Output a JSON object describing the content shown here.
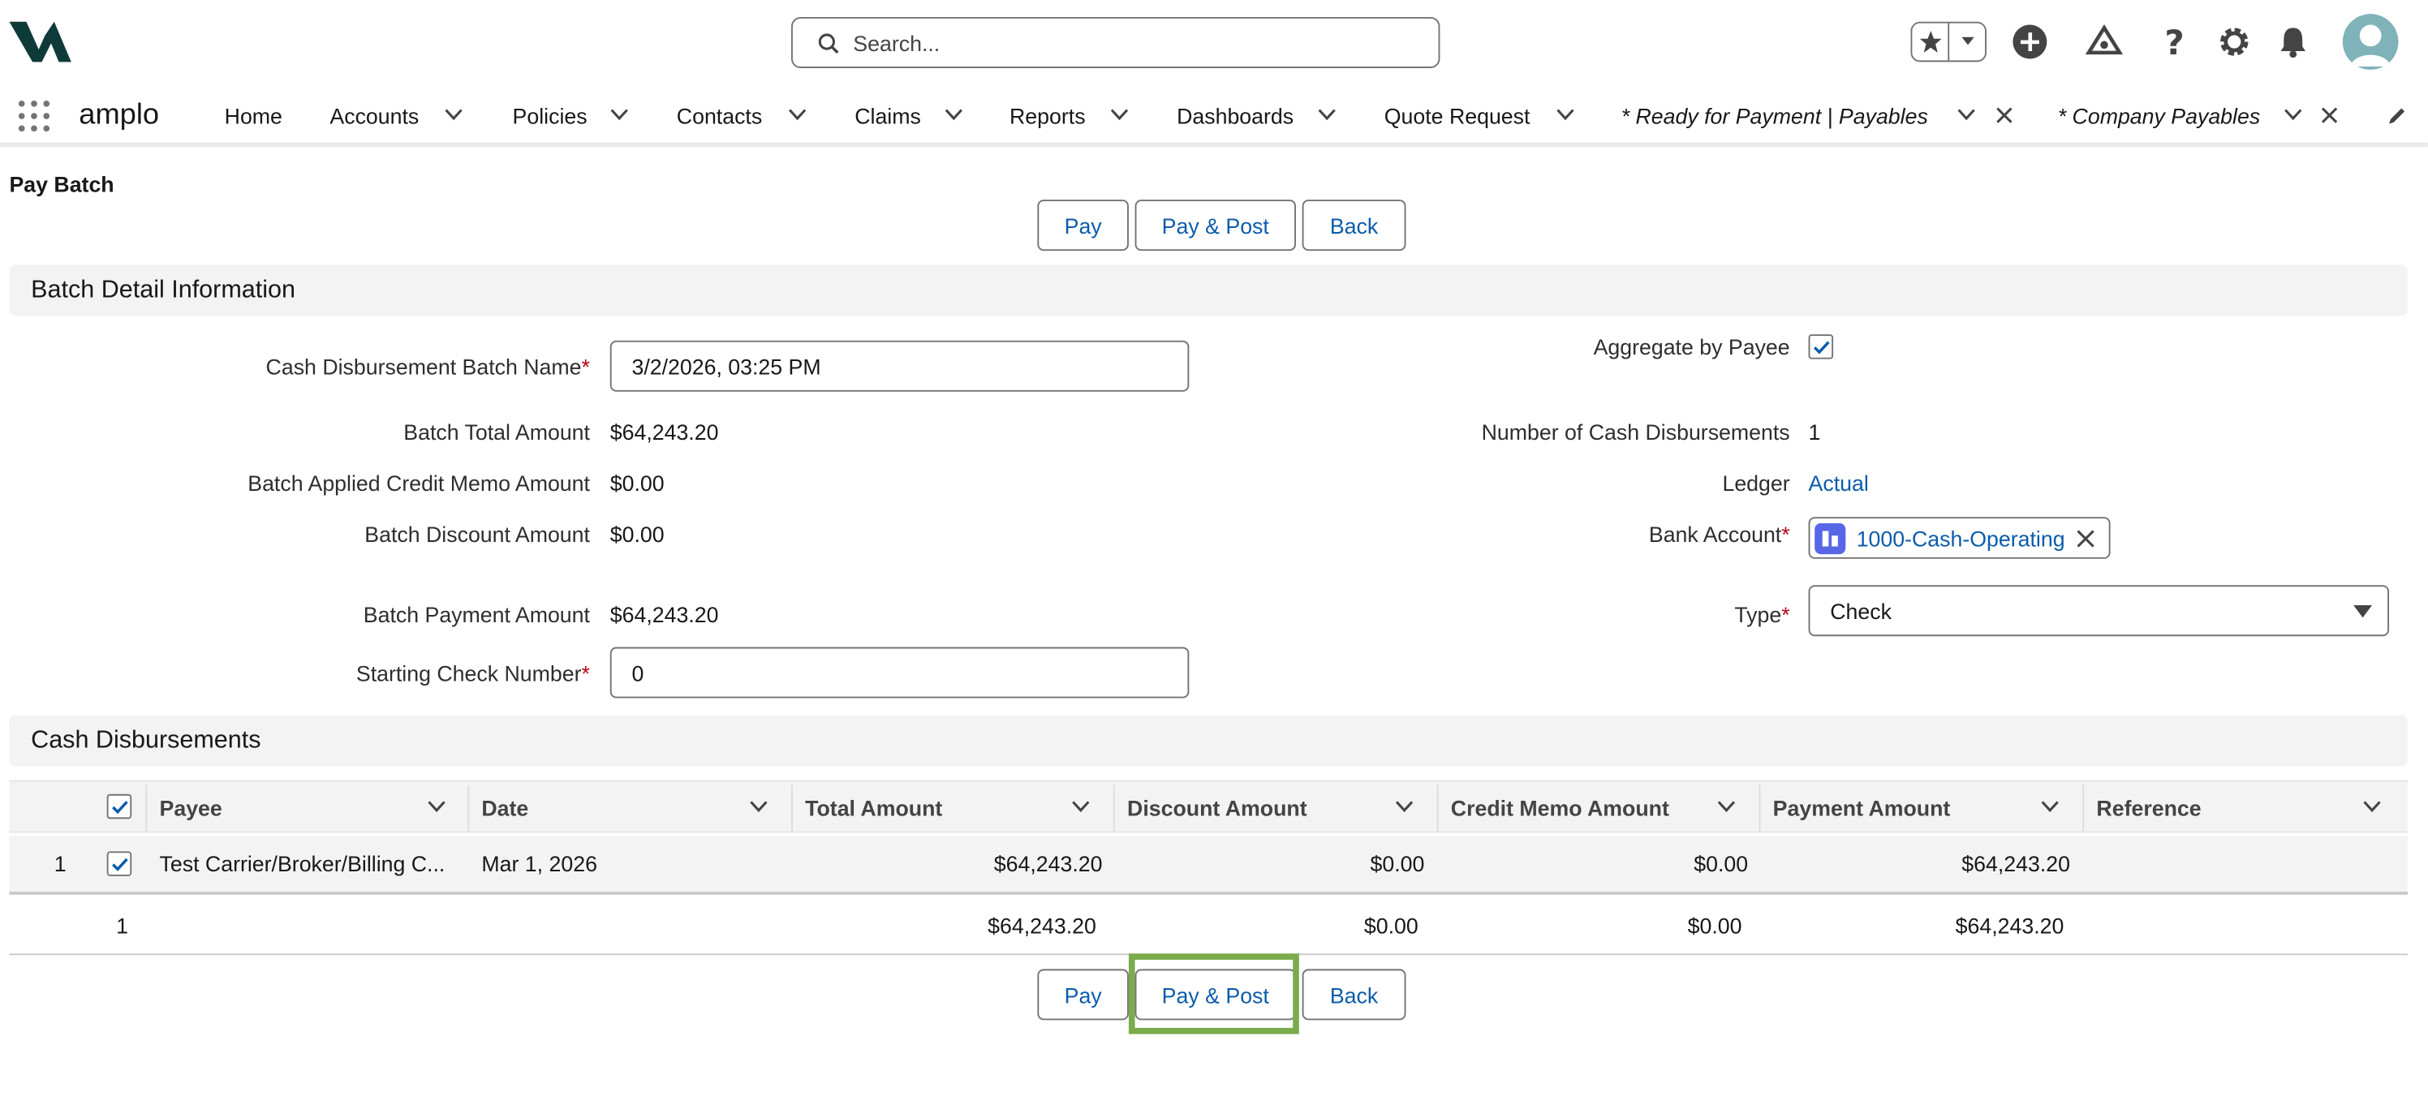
{
  "header": {
    "search_placeholder": "Search...",
    "icons": [
      "logo-icon",
      "star-icon",
      "chevron-down-icon",
      "plus-circle-icon",
      "trailhead-icon",
      "help-icon",
      "gear-icon",
      "bell-icon",
      "avatar-icon"
    ]
  },
  "nav": {
    "app_name": "amplo",
    "items": [
      "Home",
      "Accounts",
      "Policies",
      "Contacts",
      "Claims",
      "Reports",
      "Dashboards",
      "Quote Request"
    ],
    "tabs": [
      "* Ready for Payment | Payables",
      "* Company Payables"
    ]
  },
  "page": {
    "title": "Pay Batch",
    "buttons": {
      "pay": "Pay",
      "pay_post": "Pay & Post",
      "back": "Back"
    }
  },
  "batch": {
    "section_title": "Batch Detail Information",
    "left": [
      {
        "label": "Cash Disbursement Batch Name",
        "value": "3/2/2026, 03:25 PM"
      },
      {
        "label": "Batch Total Amount",
        "value": "$64,243.20"
      },
      {
        "label": "Batch Applied Credit Memo Amount",
        "value": "$0.00"
      },
      {
        "label": "Batch Discount Amount",
        "value": "$0.00"
      },
      {
        "label": "Batch Payment Amount",
        "value": "$64,243.20"
      },
      {
        "label": "Starting Check Number",
        "value": "0"
      }
    ],
    "right": [
      {
        "label": "Aggregate by Payee",
        "value": "checked"
      },
      {
        "label": "Number of Cash Disbursements",
        "value": "1"
      },
      {
        "label": "Ledger",
        "value": "Actual"
      },
      {
        "label": "Bank Account",
        "value": "1000-Cash-Operating"
      },
      {
        "label": "Type",
        "value": "Check"
      }
    ],
    "required_mark": "*"
  },
  "disbursements": {
    "section_title": "Cash Disbursements",
    "columns": [
      "Payee",
      "Date",
      "Total Amount",
      "Discount Amount",
      "Credit Memo Amount",
      "Payment Amount",
      "Reference"
    ],
    "rows": [
      {
        "num": "1",
        "payee": "Test Carrier/Broker/Billing C...",
        "date": "Mar 1, 2026",
        "total": "$64,243.20",
        "discount": "$0.00",
        "credit": "$0.00",
        "payment": "$64,243.20",
        "reference": ""
      }
    ],
    "footer": {
      "count": "1",
      "total": "$64,243.20",
      "discount": "$0.00",
      "credit": "$0.00",
      "payment": "$64,243.20"
    }
  },
  "colors": {
    "link": "#0b5cab",
    "highlight": "#7aac4b",
    "required": "#ba0517"
  }
}
